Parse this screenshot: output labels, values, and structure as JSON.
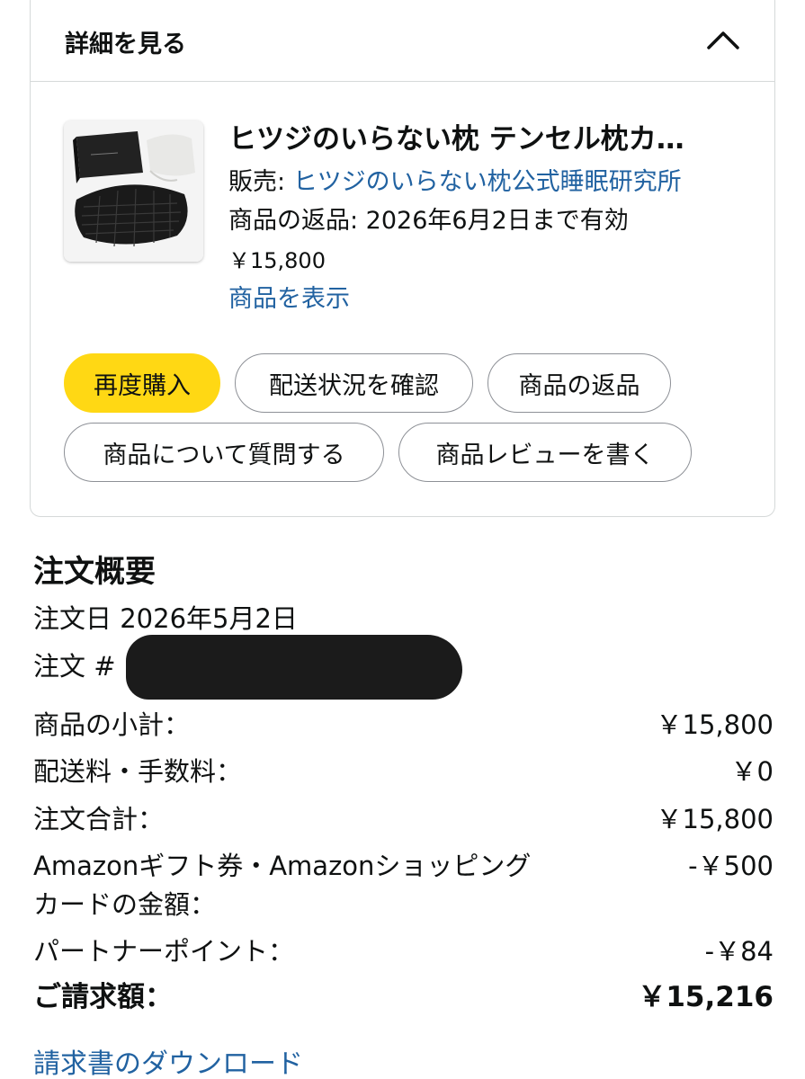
{
  "details": {
    "header_label": "詳細を見る",
    "product": {
      "title": "ヒツジのいらない枕 テンセル枕カ…",
      "seller_label": "販売: ",
      "seller_name": "ヒツジのいらない枕公式睡眠研究所",
      "return_text": "商品の返品: 2026年6月2日まで有効",
      "price": "￥15,800",
      "view_link": "商品を表示"
    },
    "actions": {
      "buy_again": "再度購入",
      "track": "配送状況を確認",
      "return": "商品の返品",
      "ask": "商品について質問する",
      "review": "商品レビューを書く"
    }
  },
  "summary": {
    "title": "注文概要",
    "order_date": "注文日 2026年5月2日",
    "order_number_label": "注文 #",
    "rows": [
      {
        "label": "商品の小計：",
        "value": "￥15,800"
      },
      {
        "label": "配送料・手数料：",
        "value": "￥0"
      },
      {
        "label": "注文合計：",
        "value": "￥15,800"
      },
      {
        "label": "Amazonギフト券・Amazonショッピング",
        "label2": "カードの金額：",
        "value": "-￥500"
      },
      {
        "label": "パートナーポイント：",
        "value": "-￥84"
      },
      {
        "label": "ご請求額：",
        "value": "￥15,216"
      }
    ],
    "download_link": "請求書のダウンロード"
  },
  "colors": {
    "accent_yellow": "#ffd814",
    "link_blue": "#2162a1",
    "border": "#d5d9d9"
  }
}
